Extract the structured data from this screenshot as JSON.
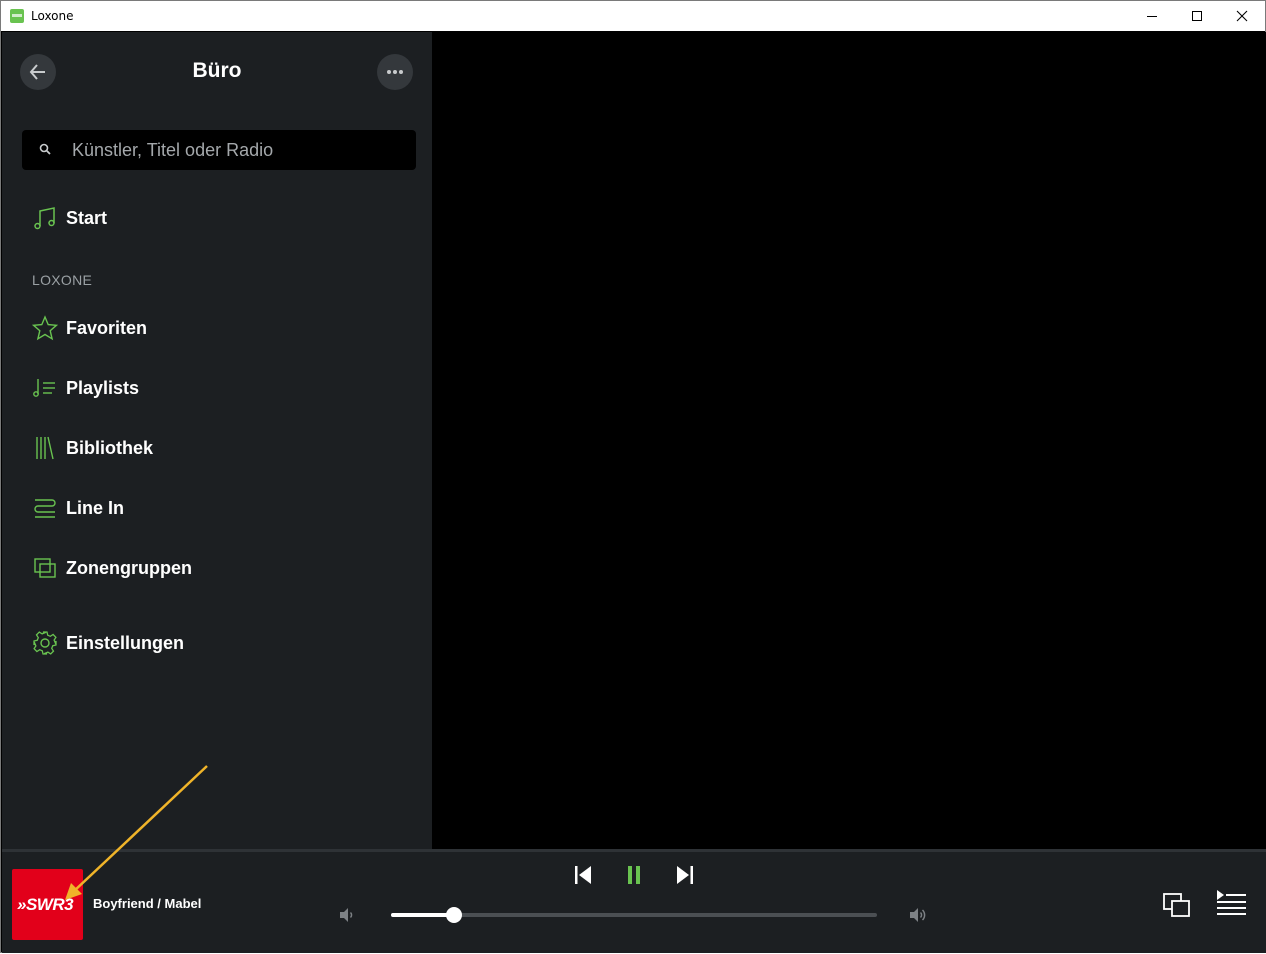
{
  "window": {
    "title": "Loxone"
  },
  "header": {
    "title": "Büro"
  },
  "search": {
    "placeholder": "Künstler, Titel oder Radio"
  },
  "nav": {
    "start": "Start",
    "section_label": "LOXONE",
    "items": [
      "Favoriten",
      "Playlists",
      "Bibliothek",
      "Line In",
      "Zonengruppen"
    ],
    "settings": "Einstellungen"
  },
  "player": {
    "cover_text": "»SWR3",
    "track": "Boyfriend / Mabel",
    "volume_fraction": 0.13
  },
  "colors": {
    "accent": "#69c350",
    "sidebar": "#1c1f22",
    "cover": "#e2001a",
    "annotation": "#f0b429"
  }
}
